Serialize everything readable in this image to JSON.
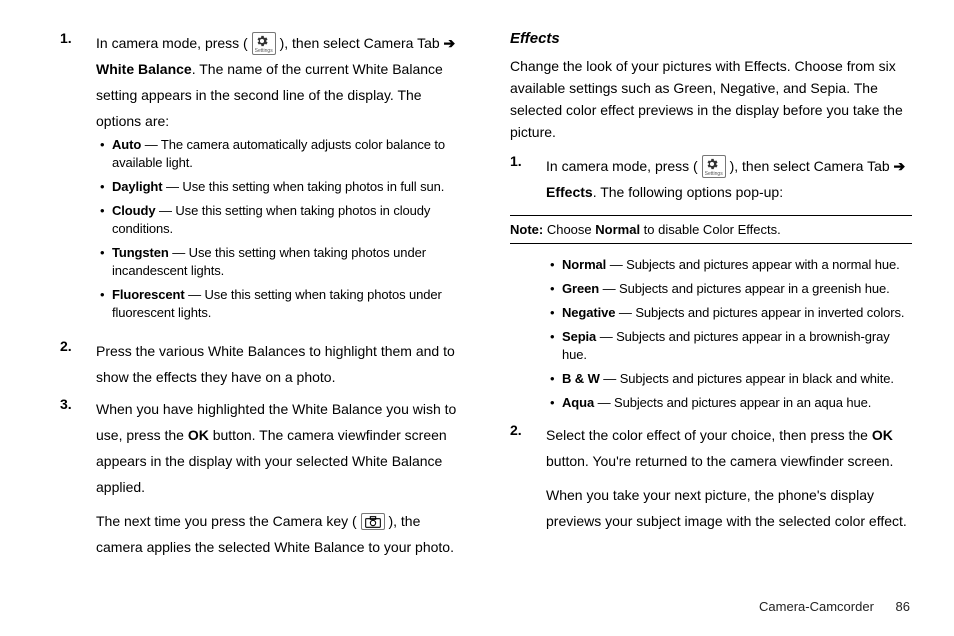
{
  "left": {
    "step1": {
      "num": "1.",
      "pre": "In camera mode, press (",
      "post_icon": "), then select Camera Tab ",
      "arrow": "➔",
      "bold1": "White Balance",
      "tail": ". The name of the current White Balance setting appears in the second line of the display. The options are:"
    },
    "wb_opts": [
      {
        "name": "Auto",
        "desc": " — The camera automatically adjusts color balance to available light."
      },
      {
        "name": "Daylight",
        "desc": " — Use this setting when taking photos in full sun."
      },
      {
        "name": "Cloudy",
        "desc": " — Use this setting when taking photos in cloudy conditions."
      },
      {
        "name": "Tungsten",
        "desc": " — Use this setting when taking photos under incandescent lights."
      },
      {
        "name": "Fluorescent",
        "desc": " — Use this setting when taking photos under fluorescent lights."
      }
    ],
    "step2": {
      "num": "2.",
      "text": "Press the various White Balances to highlight them and to show the effects they have on a photo."
    },
    "step3": {
      "num": "3.",
      "pre": "When you have highlighted the White Balance you wish to use, press the ",
      "ok": "OK",
      "post": " button. The camera viewfinder screen appears in the display with your selected White Balance applied."
    },
    "step3b_pre": "The next time you press the Camera key (",
    "step3b_post": "), the camera applies the selected White Balance to your photo."
  },
  "right": {
    "heading": "Effects",
    "intro": "Change the look of your pictures with Effects. Choose from six available settings such as Green, Negative, and Sepia. The selected color effect previews in the display before you take the picture.",
    "step1": {
      "num": "1.",
      "pre": "In camera mode, press (",
      "post_icon": "), then select Camera Tab ",
      "arrow": "➔",
      "bold1": "Effects",
      "tail": ". The following options pop-up:"
    },
    "note": {
      "label": "Note:",
      "pre": " Choose ",
      "bold": "Normal",
      "post": " to disable Color Effects."
    },
    "fx_opts": [
      {
        "name": "Normal",
        "desc": " — Subjects and pictures appear with a normal hue."
      },
      {
        "name": "Green",
        "desc": " — Subjects and pictures appear in a greenish hue."
      },
      {
        "name": "Negative",
        "desc": " — Subjects and pictures appear in inverted colors."
      },
      {
        "name": "Sepia",
        "desc": " — Subjects and pictures appear in a brownish-gray hue."
      },
      {
        "name": "B & W",
        "desc": " — Subjects and pictures appear in black and white."
      },
      {
        "name": "Aqua",
        "desc": " — Subjects and pictures appear in an aqua hue."
      }
    ],
    "step2": {
      "num": "2.",
      "pre": "Select the color effect of your choice, then press the ",
      "ok": "OK",
      "post": " button. You're returned to the camera viewfinder screen."
    },
    "step2b": "When you take your next picture, the phone's display previews your subject image with the selected color effect."
  },
  "footer": {
    "section": "Camera-Camcorder",
    "page": "86"
  },
  "icons": {
    "settings_caption": "Settings"
  }
}
